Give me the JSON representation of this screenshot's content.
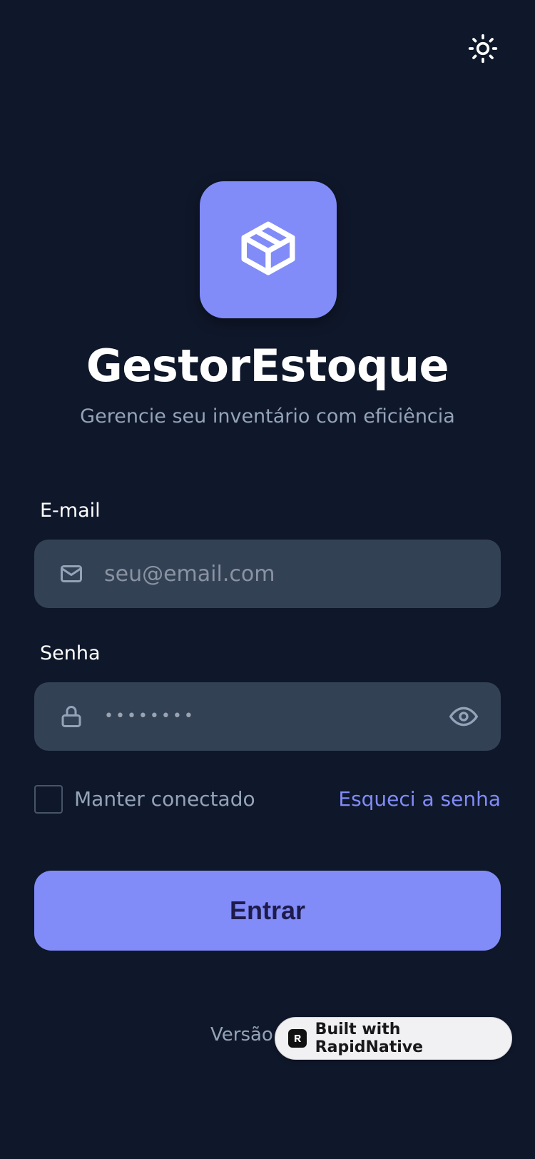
{
  "header": {
    "theme_toggle_icon": "sun-icon"
  },
  "brand": {
    "logo_icon": "package-box-icon",
    "title": "GestorEstoque",
    "subtitle": "Gerencie seu inventário com eficiência"
  },
  "form": {
    "email": {
      "label": "E-mail",
      "placeholder": "seu@email.com",
      "value": "",
      "icon": "mail-icon"
    },
    "password": {
      "label": "Senha",
      "masked_value": "••••••••",
      "icon": "lock-icon",
      "toggle_icon": "eye-icon"
    },
    "remember_me": {
      "label": "Manter conectado",
      "checked": false
    },
    "forgot_password_label": "Esqueci a senha",
    "submit_label": "Entrar"
  },
  "footer": {
    "version_text": "Versão"
  },
  "badge": {
    "label": "Built with RapidNative"
  },
  "colors": {
    "background": "#0f172a",
    "accent": "#818cf8",
    "field_background": "#334155",
    "muted_text": "#94a3b8"
  }
}
